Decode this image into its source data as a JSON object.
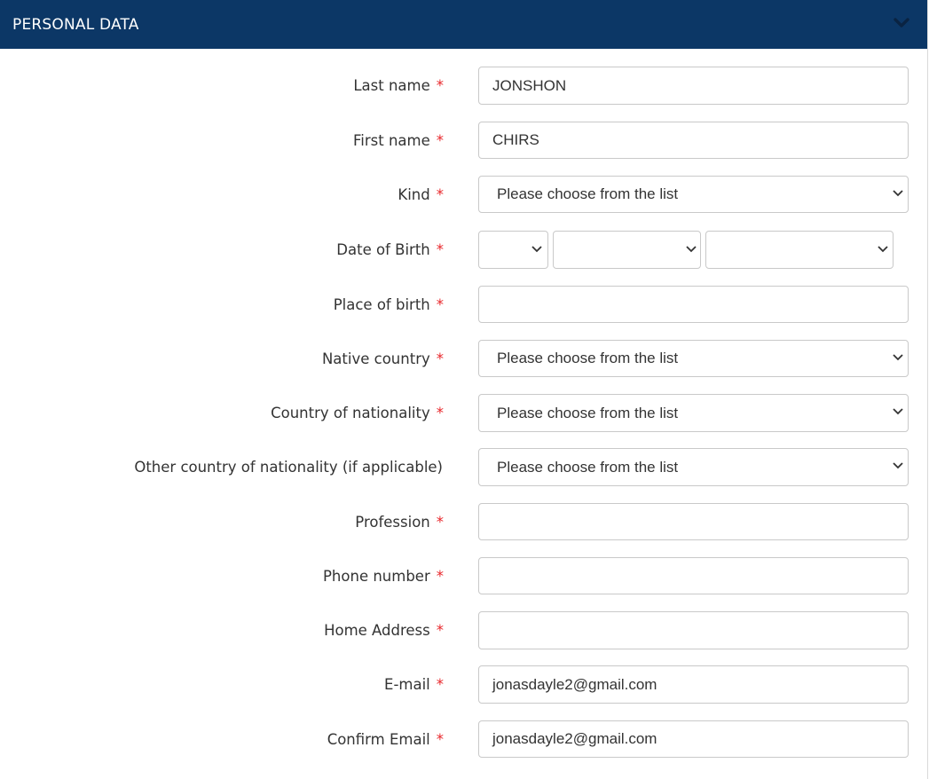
{
  "header": {
    "title": "PERSONAL DATA",
    "toggle_icon": "chevron-down-icon"
  },
  "required_mark": "*",
  "form": {
    "last_name": {
      "label": "Last name",
      "value": "JONSHON"
    },
    "first_name": {
      "label": "First name",
      "value": "CHIRS"
    },
    "kind": {
      "label": "Kind",
      "value": "Please choose from the list"
    },
    "date_of_birth": {
      "label": "Date of Birth",
      "day": "",
      "month": "",
      "year": ""
    },
    "place_of_birth": {
      "label": "Place of birth",
      "value": ""
    },
    "native_country": {
      "label": "Native country",
      "value": "Please choose from the list"
    },
    "country_of_nationality": {
      "label": "Country of nationality",
      "value": "Please choose from the list"
    },
    "other_country_of_nationality": {
      "label": "Other country of nationality (if applicable)",
      "value": "Please choose from the list"
    },
    "profession": {
      "label": "Profession",
      "value": ""
    },
    "phone_number": {
      "label": "Phone number",
      "value": ""
    },
    "home_address": {
      "label": "Home Address",
      "value": ""
    },
    "email": {
      "label": "E-mail",
      "value": "jonasdayle2@gmail.com"
    },
    "confirm_email": {
      "label": "Confirm Email",
      "value": "jonasdayle2@gmail.com"
    }
  },
  "colors": {
    "header_bg": "#0c3766",
    "required": "#e8262a",
    "border": "#c9c9c9"
  }
}
